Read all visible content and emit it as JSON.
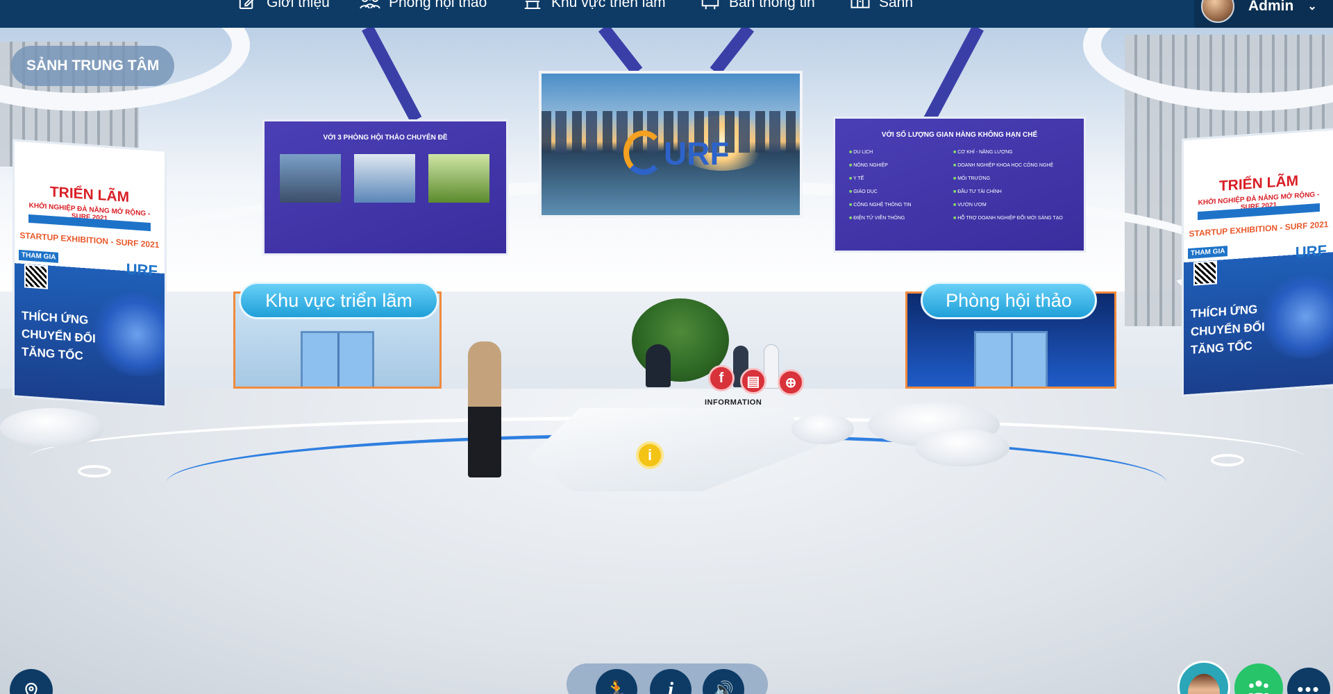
{
  "nav": {
    "items": [
      {
        "label": "Giới thiệu",
        "icon": "edit-icon"
      },
      {
        "label": "Phòng hội thảo",
        "icon": "people-icon"
      },
      {
        "label": "Khu vực triển lãm",
        "icon": "exhibition-icon"
      },
      {
        "label": "Bản thông tin",
        "icon": "info-board-icon"
      },
      {
        "label": "Sảnh",
        "icon": "lobby-icon"
      }
    ],
    "user": {
      "name": "Admin",
      "chevron": "⌄"
    }
  },
  "location": {
    "label": "SẢNH TRUNG TÂM"
  },
  "banner": {
    "title": "TRIỂN LÃM",
    "subtitle": "KHỞI NGHIỆP ĐÀ NẴNG MỞ RỘNG - SURF 2021",
    "startup": "STARTUP EXHIBITION - SURF 2021",
    "thamgia": "THAM GIA",
    "brand": "URF",
    "slogan": [
      "THÍCH ỨNG",
      "CHUYỂN ĐỔI",
      "TĂNG TỐC"
    ]
  },
  "left_screen": {
    "title": "VỚI 3 PHÒNG HỘI THẢO CHUYÊN ĐỀ"
  },
  "right_screen": {
    "title": "VỚI SỐ LƯỢNG GIAN HÀNG KHÔNG HẠN CHẾ",
    "items": [
      "DU LỊCH",
      "CƠ KHÍ - NĂNG LƯỢNG",
      "NÔNG NGHIỆP",
      "DOANH NGHIỆP KHOA HỌC CÔNG NGHỆ",
      "Y TẾ",
      "MÔI TRƯỜNG",
      "GIÁO DỤC",
      "ĐẦU TƯ TÀI CHÍNH",
      "CÔNG NGHỆ THÔNG TIN",
      "VƯỜN ƯƠM",
      "ĐIỆN TỬ VIỄN THÔNG",
      "HỖ TRỢ DOANH NGHIỆP ĐỔI MỚI SÁNG TẠO"
    ]
  },
  "center_screen": {
    "logo": "URF"
  },
  "portals": {
    "expo": {
      "label": "Khu vực triển lãm"
    },
    "conference": {
      "label": "Phòng hội thảo"
    }
  },
  "reception": {
    "info_label": "INFORMATION",
    "info_hotspot": "i",
    "social": [
      {
        "icon": "facebook-icon",
        "glyph": "f"
      },
      {
        "icon": "document-icon",
        "glyph": "▤"
      },
      {
        "icon": "website-icon",
        "glyph": "⊕"
      }
    ]
  },
  "bottom_controls": [
    {
      "icon": "walk-icon",
      "glyph": "🏃"
    },
    {
      "icon": "info-icon",
      "glyph": "i"
    },
    {
      "icon": "sound-icon",
      "glyph": "🔊"
    }
  ],
  "colors": {
    "nav_bg": "#0d3b66",
    "accent_blue": "#2f7fe0",
    "screen_purple": "#3a2d9e",
    "social_red": "#d8323a",
    "hotspot_yellow": "#f3c316",
    "chat_green": "#27c46a"
  }
}
